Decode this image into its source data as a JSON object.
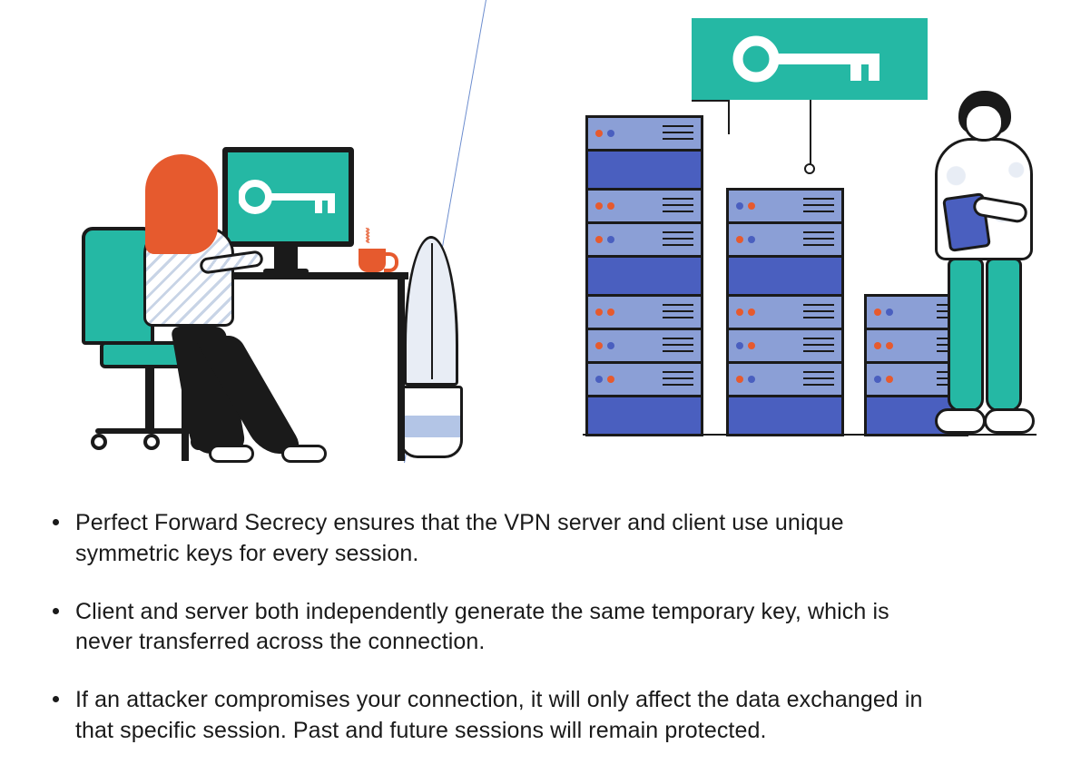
{
  "colors": {
    "teal": "#25b8a4",
    "orange": "#e65a2e",
    "purple_light": "#8b9fd6",
    "purple_dark": "#4a5fbf",
    "ink": "#1a1a1a"
  },
  "icons": {
    "client_key": "key-icon",
    "server_key": "key-icon"
  },
  "scenes": {
    "left": "client-at-desk",
    "right": "server-rack-admin"
  },
  "bullets": [
    "Perfect Forward Secrecy ensures that the VPN server and client use unique symmetric keys for every session.",
    "Client and server both independently generate the same temporary key, which is never transferred across the connection.",
    "If an attacker compromises your connection, it will only affect the data exchanged in that specific session. Past and future sessions will remain protected."
  ]
}
